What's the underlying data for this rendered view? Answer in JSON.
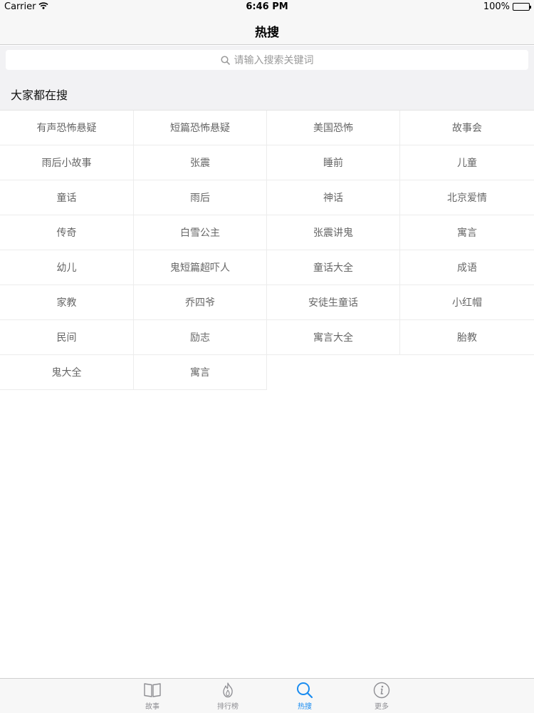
{
  "status_bar": {
    "carrier": "Carrier",
    "time": "6:46 PM",
    "battery": "100%",
    "battery_level": 1.0
  },
  "nav": {
    "title": "热搜"
  },
  "search": {
    "placeholder": "请输入搜索关键词",
    "icon": "search-icon"
  },
  "section": {
    "title": "大家都在搜"
  },
  "keywords": [
    "有声恐怖悬疑",
    "短篇恐怖悬疑",
    "美国恐怖",
    "故事会",
    "雨后小故事",
    "张震",
    "睡前",
    "儿童",
    "童话",
    "雨后",
    "神话",
    "北京爱情",
    "传奇",
    "白雪公主",
    "张震讲鬼",
    "寓言",
    "幼儿",
    "鬼短篇超吓人",
    "童话大全",
    "成语",
    "家教",
    "乔四爷",
    "安徒生童话",
    "小红帽",
    "民间",
    "励志",
    "寓言大全",
    "胎教",
    "鬼大全",
    "寓言"
  ],
  "tabs": [
    {
      "label": "故事",
      "icon": "book-icon",
      "active": false
    },
    {
      "label": "排行榜",
      "icon": "flame-icon",
      "active": false
    },
    {
      "label": "热搜",
      "icon": "search-icon",
      "active": true
    },
    {
      "label": "更多",
      "icon": "info-icon",
      "active": false
    }
  ],
  "colors": {
    "accent": "#1a8cf0",
    "inactive_tab": "#8e8e93",
    "keyword_text": "#666666"
  }
}
